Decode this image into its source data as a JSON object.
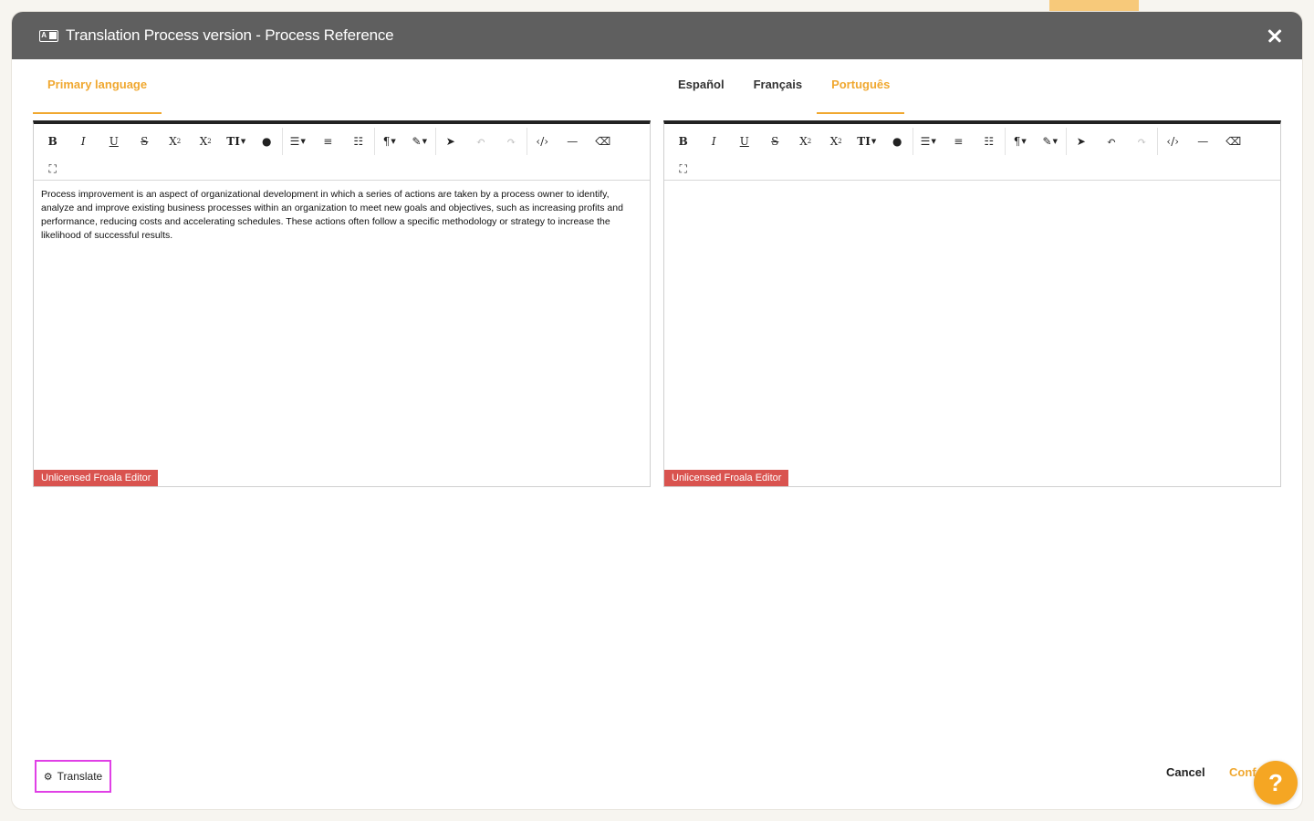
{
  "modal": {
    "title": "Translation Process version - Process Reference"
  },
  "left_pane": {
    "tabs": [
      {
        "label": "Primary language",
        "active": true
      }
    ],
    "content": "Process improvement is an aspect of organizational development in which a series of actions are taken by a process owner to identify, analyze and improve existing business processes within an organization to meet new goals and objectives, such as increasing profits and performance, reducing costs and accelerating schedules. These actions often follow a specific methodology or strategy to increase the likelihood of successful results.",
    "license": "Unlicensed Froala Editor"
  },
  "right_pane": {
    "tabs": [
      {
        "label": "Español",
        "active": false
      },
      {
        "label": "Français",
        "active": false
      },
      {
        "label": "Português",
        "active": true
      }
    ],
    "content": "",
    "license": "Unlicensed Froala Editor"
  },
  "toolbar": {
    "bold": "B",
    "italic": "I",
    "underline": "U",
    "strike": "S",
    "subscript": "X",
    "superscript": "X",
    "font_size": "TI"
  },
  "footer": {
    "translate_label": "Translate",
    "cancel_label": "Cancel",
    "confirm_label": "Conf",
    "help_label": "?"
  },
  "colors": {
    "accent": "#f0a830",
    "header": "#5f5f5f",
    "license": "#d9534f",
    "highlight": "#e040e6"
  }
}
